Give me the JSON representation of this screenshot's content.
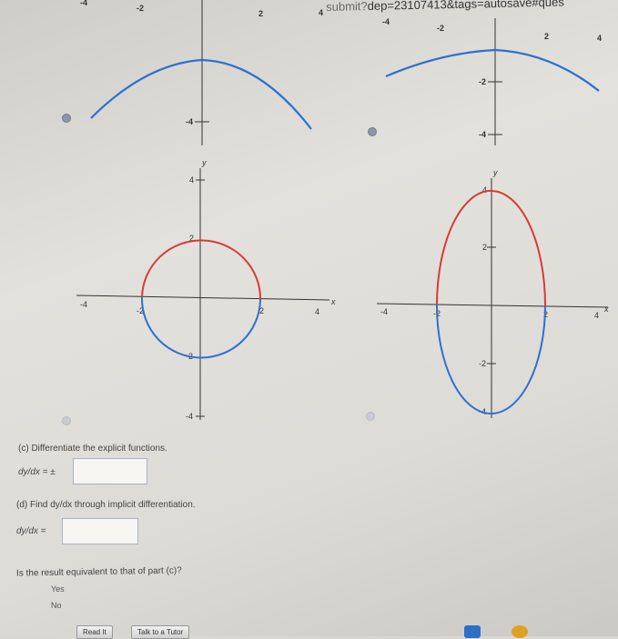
{
  "browser": {
    "url_fragment": "submit?dep=23107413&tags=autosave#ques",
    "url_visible_part": "dep=23107413&tags=autosave#ques",
    "url_faded_part": "submit?"
  },
  "graphs": {
    "top_left": {
      "ticks_top": [
        "-4",
        "-2",
        "2",
        "4"
      ],
      "tick_y": "-4"
    },
    "top_right": {
      "ticks_top": [
        "-4",
        "-2",
        "2",
        "4"
      ],
      "tick_y1": "-2",
      "tick_y2": "-4"
    },
    "bottom_left": {
      "y_axis_label": "y",
      "x_axis_label": "x",
      "y_ticks": [
        "4",
        "2",
        "-2",
        "-4"
      ],
      "x_ticks": [
        "-4",
        "-2",
        "2",
        "4"
      ]
    },
    "bottom_right": {
      "y_axis_label": "y",
      "x_axis_label": "x",
      "y_ticks": [
        "4",
        "2",
        "-2",
        "-4"
      ],
      "x_ticks": [
        "-4",
        "-2",
        "2",
        "4"
      ]
    },
    "colors": {
      "upper_curve": "#d83a3a",
      "lower_curve": "#2e6fd1",
      "axes": "#333333"
    }
  },
  "part_c": {
    "prompt": "(c) Differentiate the explicit functions.",
    "answer_label": "dy/dx = ±",
    "answer_value": ""
  },
  "part_d": {
    "prompt": "(d) Find dy/dx through implicit differentiation.",
    "answer_label": "dy/dx =",
    "answer_value": ""
  },
  "equivalence": {
    "question": "Is the result equivalent to that of part (c)?",
    "options": [
      "Yes",
      "No"
    ]
  },
  "buttons": {
    "read_it": "Read It",
    "talk_to_tutor": "Talk to a Tutor"
  }
}
